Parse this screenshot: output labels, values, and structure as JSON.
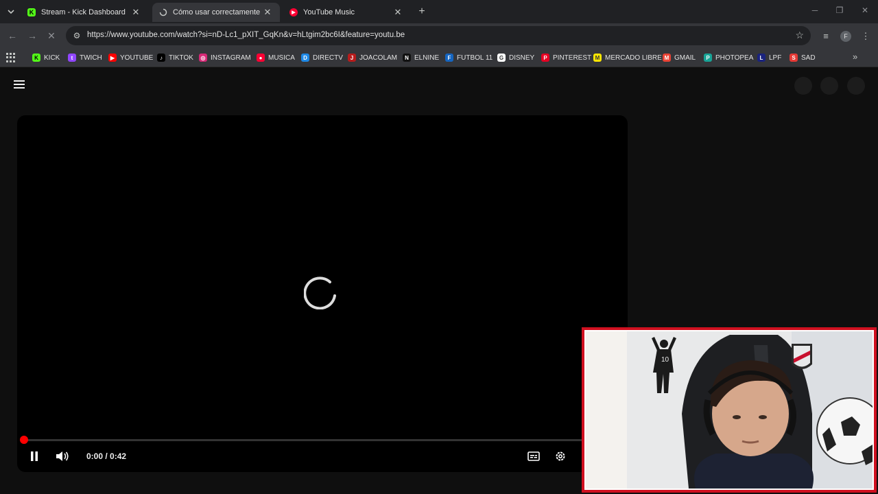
{
  "tabs": [
    {
      "title": "Stream - Kick Dashboard",
      "favicon": "kick-icon",
      "active": false
    },
    {
      "title": "Cómo usar correctamente una",
      "favicon": "loading-icon",
      "active": true
    },
    {
      "title": "YouTube Music",
      "favicon": "youtube-music-icon",
      "active": false
    }
  ],
  "address": {
    "url": "https://www.youtube.com/watch?si=nD-Lc1_pXIT_GqKn&v=hLtgim2bc6I&feature=youtu.be"
  },
  "profile_initial": "F",
  "bookmarks": [
    {
      "label": "KICK",
      "color": "#53fc18",
      "text_color": "#000",
      "glyph": "K"
    },
    {
      "label": "TWICH",
      "color": "#9146ff",
      "text_color": "#fff",
      "glyph": "t"
    },
    {
      "label": "YOUTUBE",
      "color": "#ff0000",
      "text_color": "#fff",
      "glyph": "▶"
    },
    {
      "label": "TIKTOK",
      "color": "#000000",
      "text_color": "#fff",
      "glyph": "♪"
    },
    {
      "label": "INSTAGRAM",
      "color": "#d62976",
      "text_color": "#fff",
      "glyph": "◎"
    },
    {
      "label": "MUSICA",
      "color": "#ff0033",
      "text_color": "#fff",
      "glyph": "●"
    },
    {
      "label": "DIRECTV",
      "color": "#1e88e5",
      "text_color": "#fff",
      "glyph": "D"
    },
    {
      "label": "JOACOLAM",
      "color": "#b71c1c",
      "text_color": "#fff",
      "glyph": "J"
    },
    {
      "label": "ELNINE",
      "color": "#111111",
      "text_color": "#fff",
      "glyph": "N"
    },
    {
      "label": "FUTBOL 11",
      "color": "#1565c0",
      "text_color": "#fff",
      "glyph": "F"
    },
    {
      "label": "DISNEY",
      "color": "#ffffff",
      "text_color": "#333",
      "glyph": "G"
    },
    {
      "label": "PINTEREST",
      "color": "#e60023",
      "text_color": "#fff",
      "glyph": "P"
    },
    {
      "label": "MERCADO LIBRE",
      "color": "#ffe600",
      "text_color": "#333",
      "glyph": "M"
    },
    {
      "label": "GMAIL",
      "color": "#ea4335",
      "text_color": "#fff",
      "glyph": "M"
    },
    {
      "label": "PHOTOPEA",
      "color": "#18a497",
      "text_color": "#fff",
      "glyph": "P"
    },
    {
      "label": "LPF",
      "color": "#1a237e",
      "text_color": "#fff",
      "glyph": "L"
    },
    {
      "label": "SAD",
      "color": "#e53935",
      "text_color": "#fff",
      "glyph": "S"
    }
  ],
  "player": {
    "time": "0:00 / 0:42",
    "progress": 0.0,
    "state": "loading"
  }
}
